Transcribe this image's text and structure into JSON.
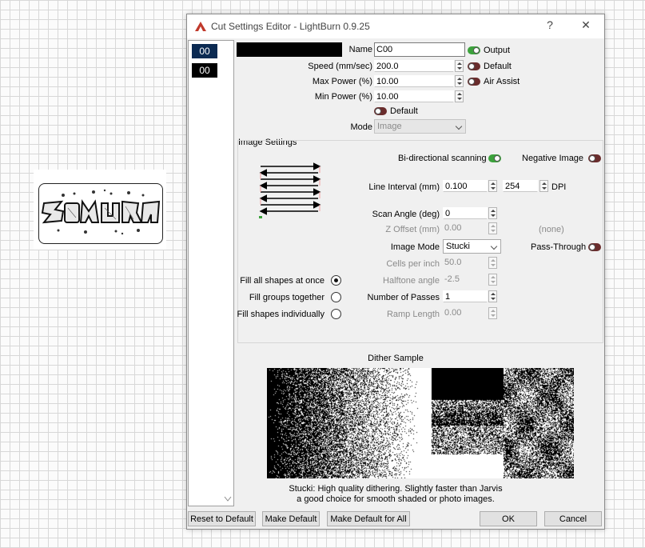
{
  "window": {
    "title": "Cut Settings Editor - LightBurn 0.9.25",
    "help": "?",
    "close": "✕"
  },
  "layers": [
    {
      "label": "00",
      "color": "#0b2a52"
    },
    {
      "label": "00",
      "color": "#000000"
    }
  ],
  "layer_color": "#000000",
  "fields": {
    "name_label": "Name",
    "name_value": "C00",
    "output_label": "Output",
    "speed_label": "Speed (mm/sec)",
    "speed_value": "200.0",
    "default_label": "Default",
    "max_power_label": "Max Power (%)",
    "max_power_value": "10.00",
    "air_assist_label": "Air Assist",
    "min_power_label": "Min Power (%)",
    "min_power_value": "10.00",
    "default2_label": "Default",
    "mode_label": "Mode",
    "mode_value": "Image"
  },
  "toggles": {
    "output": true,
    "default": false,
    "air_assist": false,
    "default2": false,
    "bidirectional": true,
    "negative_image": false,
    "pass_through": false
  },
  "image_settings": {
    "group_title": "Image Settings",
    "bidirectional_label": "Bi-directional scanning",
    "negative_label": "Negative Image",
    "line_interval_label": "Line Interval (mm)",
    "line_interval_value": "0.100",
    "dpi_value": "254",
    "dpi_label": "DPI",
    "scan_angle_label": "Scan Angle (deg)",
    "scan_angle_value": "0",
    "z_offset_label": "Z Offset (mm)",
    "z_offset_value": "0.00",
    "z_offset_none": "(none)",
    "image_mode_label": "Image Mode",
    "image_mode_value": "Stucki",
    "pass_through_label": "Pass-Through",
    "cells_label": "Cells per inch",
    "cells_value": "50.0",
    "halftone_label": "Halftone angle",
    "halftone_value": "-2.5",
    "passes_label": "Number of Passes",
    "passes_value": "1",
    "ramp_label": "Ramp Length",
    "ramp_value": "0.00",
    "fill_all": "Fill all shapes at once",
    "fill_groups": "Fill groups together",
    "fill_individually": "Fill shapes individually",
    "fill_selected": "fill_all"
  },
  "dither": {
    "title": "Dither Sample",
    "desc1": "Stucki: High quality dithering. Slightly faster than Jarvis",
    "desc2": "a good choice for smooth shaded or photo images."
  },
  "buttons": {
    "reset": "Reset to Default",
    "make_default": "Make Default",
    "make_default_all": "Make Default for All",
    "ok": "OK",
    "cancel": "Cancel"
  }
}
